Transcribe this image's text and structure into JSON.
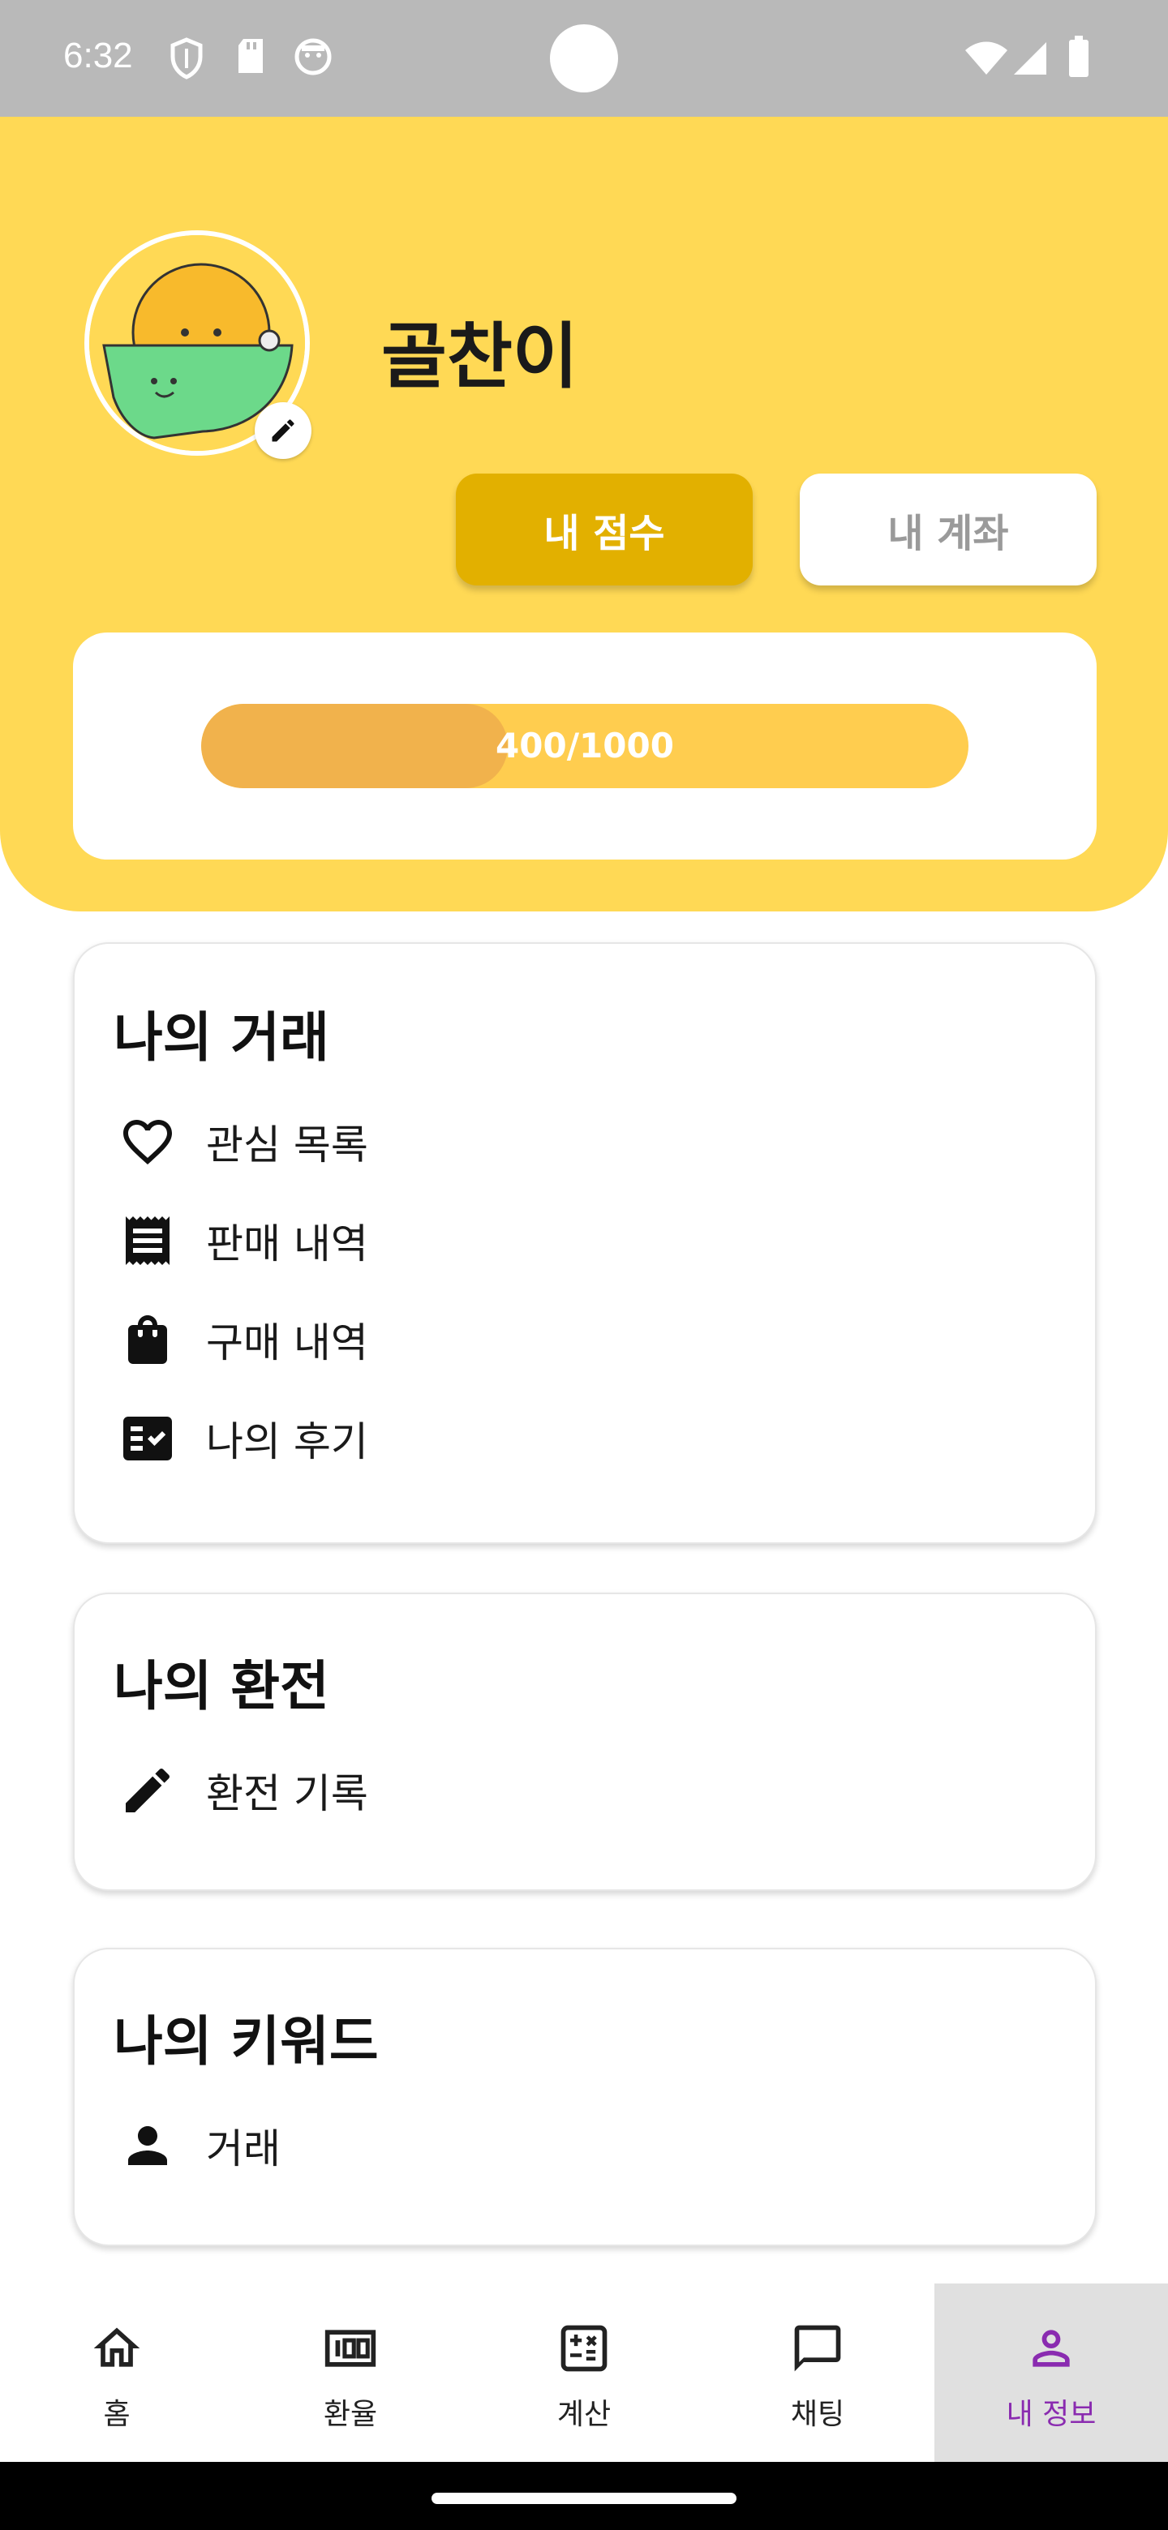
{
  "status_bar": {
    "time": "6:32",
    "icons": [
      "shield-icon",
      "sd-card-icon",
      "face-icon",
      "wifi-icon",
      "signal-icon",
      "battery-icon"
    ]
  },
  "profile": {
    "username": "골찬이",
    "avatar": "avatar-character",
    "edit_icon": "pencil-icon"
  },
  "tabs": {
    "score_label": "내 점수",
    "account_label": "내 계좌",
    "active": "score"
  },
  "score": {
    "current": 400,
    "max": 1000,
    "fraction": 0.4,
    "label": "400/1000"
  },
  "sections": [
    {
      "title": "나의 거래",
      "items": [
        {
          "label": "관심 목록",
          "icon": "heart-icon"
        },
        {
          "label": "판매 내역",
          "icon": "receipt-icon"
        },
        {
          "label": "구매 내역",
          "icon": "shopping-bag-icon"
        },
        {
          "label": "나의 후기",
          "icon": "review-checklist-icon"
        }
      ]
    },
    {
      "title": "나의 환전",
      "items": [
        {
          "label": "환전 기록",
          "icon": "pencil-icon"
        }
      ]
    },
    {
      "title": "나의 키워드",
      "items": [
        {
          "label": "거래",
          "icon": "person-icon"
        }
      ]
    }
  ],
  "bottom_nav": {
    "items": [
      {
        "label": "홈",
        "icon": "home-icon"
      },
      {
        "label": "환율",
        "icon": "exchange-rate-icon"
      },
      {
        "label": "계산",
        "icon": "calculator-icon"
      },
      {
        "label": "채팅",
        "icon": "chat-icon"
      },
      {
        "label": "내 정보",
        "icon": "person-outline-icon"
      }
    ],
    "active_index": 4,
    "active_color": "#8a2bb0"
  },
  "colors": {
    "header": "#ffd955",
    "score_button": "#e2b000",
    "progress_track": "#ffcd4f",
    "progress_fill": "#f1b24c"
  }
}
